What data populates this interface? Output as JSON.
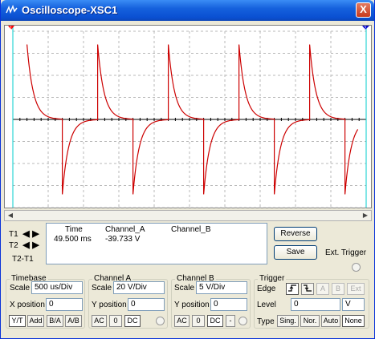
{
  "window": {
    "title": "Oscilloscope-XSC1",
    "close_glyph": "X"
  },
  "cursors": {
    "t1_label": "T1",
    "t2_label": "T2",
    "diff_label": "T2-T1",
    "marker_left": "1",
    "marker_right": "2"
  },
  "readout": {
    "headers": {
      "time": "Time",
      "channel_a": "Channel_A",
      "channel_b": "Channel_B"
    },
    "row": {
      "time": "49.500 ms",
      "channel_a": "-39.733 V",
      "channel_b": ""
    }
  },
  "buttons": {
    "reverse": "Reverse",
    "save": "Save",
    "ext_trigger": "Ext. Trigger"
  },
  "timebase": {
    "title": "Timebase",
    "scale_label": "Scale",
    "scale_value": "500 us/Div",
    "xpos_label": "X position",
    "xpos_value": "0",
    "modes": [
      "Y/T",
      "Add",
      "B/A",
      "A/B"
    ],
    "active_mode": "Y/T"
  },
  "channel_a": {
    "title": "Channel A",
    "scale_label": "Scale",
    "scale_value": "20  V/Div",
    "ypos_label": "Y position",
    "ypos_value": "0",
    "coupling": [
      "AC",
      "0",
      "DC"
    ],
    "active": "DC"
  },
  "channel_b": {
    "title": "Channel B",
    "scale_label": "Scale",
    "scale_value": "5  V/Div",
    "ypos_label": "Y position",
    "ypos_value": "0",
    "coupling": [
      "AC",
      "0",
      "DC",
      "-"
    ],
    "active": "DC"
  },
  "trigger": {
    "title": "Trigger",
    "edge_label": "Edge",
    "edge_rising": "f",
    "edge_falling": "ƭ",
    "sources": [
      "A",
      "B",
      "Ext"
    ],
    "level_label": "Level",
    "level_value": "0",
    "level_unit": "V",
    "type_label": "Type",
    "types": [
      "Sing.",
      "Nor.",
      "Auto",
      "None"
    ],
    "active_type": "None"
  },
  "colors": {
    "trace": "#cc0000",
    "cursor_t1": "#ff0000",
    "cursor_t2": "#0000cc",
    "title_bar": "#0a4fd1"
  },
  "chart_data": {
    "type": "line",
    "title": "",
    "xlabel": "",
    "ylabel": "",
    "grid": true,
    "series": [
      {
        "name": "Channel_A",
        "description": "RC differentiator spikes: positive decaying spike at each rising edge, negative decaying spike at each falling edge",
        "period_div": 2.0,
        "amplitude_div": 3.4
      }
    ]
  }
}
